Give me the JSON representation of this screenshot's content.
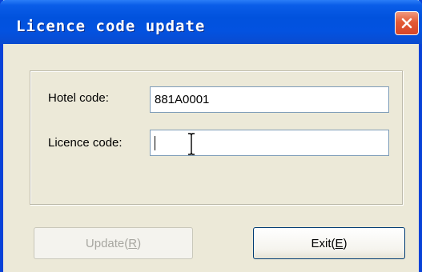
{
  "window": {
    "title": "Licence code update"
  },
  "form": {
    "hotel_code_label": "Hotel code:",
    "hotel_code_value": "881A0001",
    "licence_code_label": "Licence code:",
    "licence_code_value": ""
  },
  "buttons": {
    "update_text": "Update(",
    "update_key": "R",
    "update_close": ")",
    "exit_text": "Exit(",
    "exit_key": "E",
    "exit_close": ")"
  },
  "icons": {
    "close": "close-icon",
    "cursor": "text-cursor-icon"
  },
  "colors": {
    "titlebar": "#0152dd",
    "close": "#e35a35",
    "dialog_bg": "#ece9d8"
  }
}
